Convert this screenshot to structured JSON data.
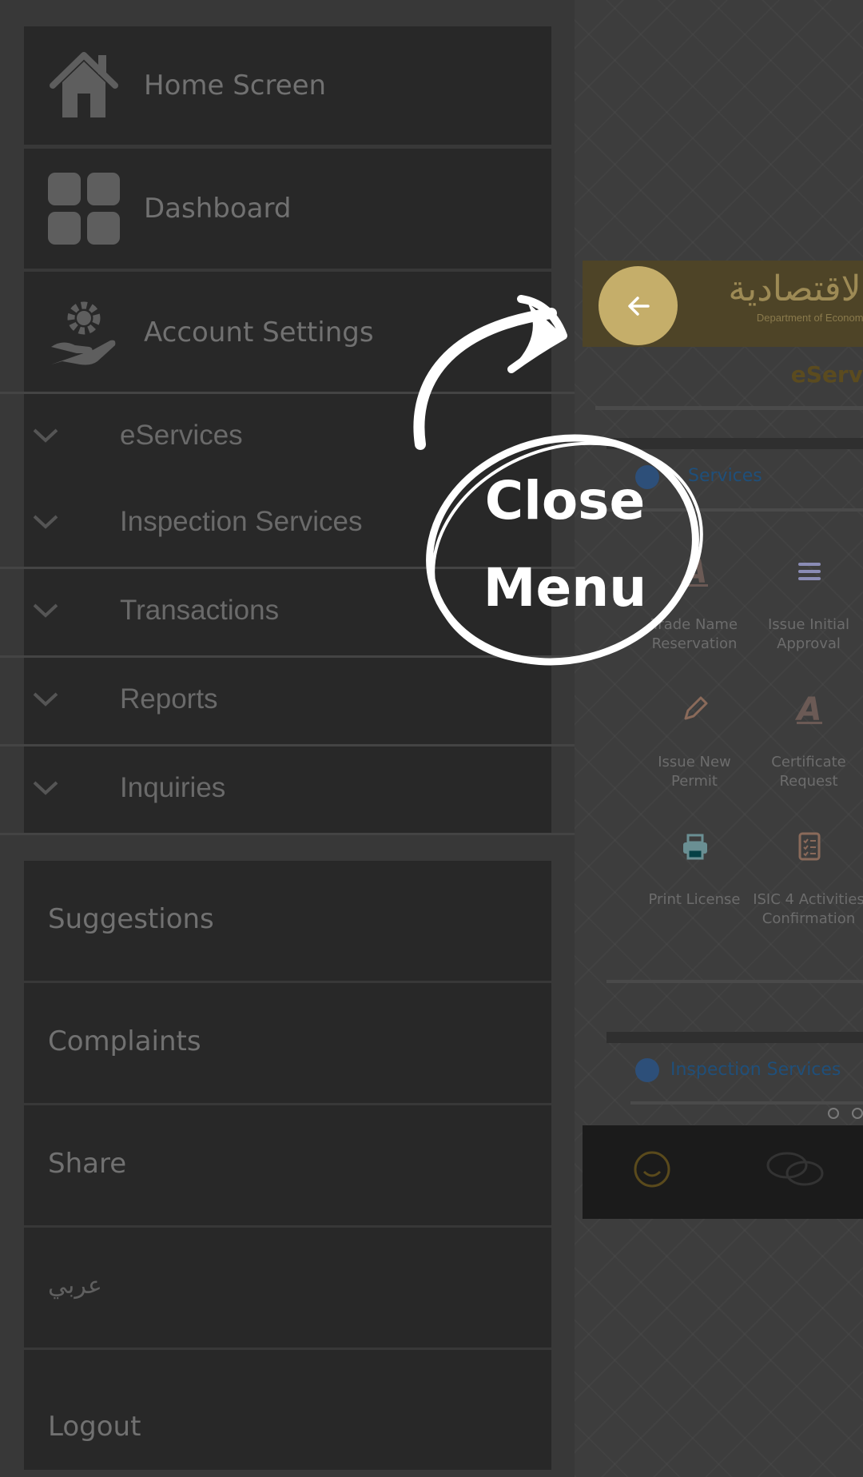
{
  "drawer": {
    "items": [
      {
        "label": "Home Screen",
        "icon": "home-icon"
      },
      {
        "label": "Dashboard",
        "icon": "grid-icon"
      },
      {
        "label": "Account Settings",
        "icon": "gear-hand-icon"
      }
    ],
    "expandable": [
      {
        "label": "eServices"
      },
      {
        "label": "Inspection Services"
      },
      {
        "label": "Transactions"
      },
      {
        "label": "Reports"
      },
      {
        "label": "Inquiries"
      }
    ],
    "links": [
      {
        "label": "Suggestions"
      },
      {
        "label": "Complaints"
      },
      {
        "label": "Share"
      },
      {
        "label": "عربي"
      },
      {
        "label": "Logout"
      }
    ]
  },
  "background_app": {
    "logo_arabic": "الاقتصادية",
    "logo_english": "Department of Economic",
    "heading": "eServ",
    "section_eservices": "Services",
    "section_inspection": "Inspection Services",
    "tiles": [
      {
        "label": "Trade Name Reservation",
        "icon": "letter-a-icon",
        "color": "#3d2a26"
      },
      {
        "label": "Issue Initial Approval",
        "icon": "lines-icon",
        "color": "#04064d"
      },
      {
        "label": "Issue New Permit",
        "icon": "pencil-icon",
        "color": "#4b220f"
      },
      {
        "label": "Certificate Request",
        "icon": "letter-a-icon",
        "color": "#3d2a26"
      },
      {
        "label": "Print License",
        "icon": "printer-icon",
        "color": "#054045"
      },
      {
        "label": "ISIC 4 Activities Confirmation",
        "icon": "checklist-icon",
        "color": "#4b220f"
      }
    ]
  },
  "annotation": {
    "line1": "Close",
    "line2": "Menu"
  },
  "colors": {
    "accent_gold": "#c5ae6a",
    "drawer_item_bg": "#282828",
    "overlay": "#3b3b3b"
  }
}
